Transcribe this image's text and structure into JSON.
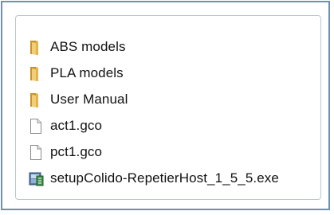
{
  "files": [
    {
      "name": "ABS models",
      "icon": "folder-icon"
    },
    {
      "name": "PLA models",
      "icon": "folder-icon"
    },
    {
      "name": "User Manual",
      "icon": "folder-icon"
    },
    {
      "name": "act1.gco",
      "icon": "file-icon"
    },
    {
      "name": "pct1.gco",
      "icon": "file-icon"
    },
    {
      "name": "setupColido-RepetierHost_1_5_5.exe",
      "icon": "installer-icon"
    }
  ],
  "colors": {
    "folder": "#e3b44a",
    "folder_dark": "#c9922c",
    "frame_border": "#6f8fb0"
  }
}
